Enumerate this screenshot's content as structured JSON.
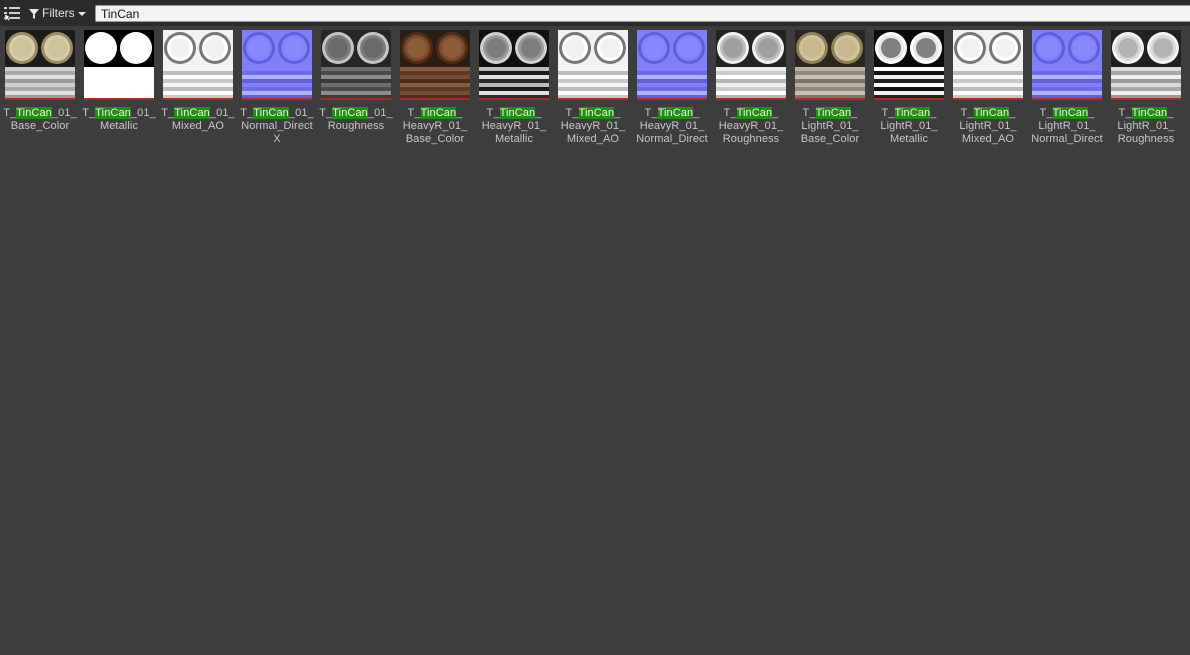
{
  "toolbar": {
    "view_icon": "view-options-icon",
    "filters_label": "Filters",
    "filter_icon": "funnel-icon",
    "dropdown_icon": "chevron-down-icon",
    "search_value": "TinCan"
  },
  "assets": [
    {
      "pre": "T_",
      "hl": "TinCan",
      "post": "_01_",
      "line2": "Base_Color",
      "line3": "",
      "kind": "basecolor"
    },
    {
      "pre": "T_",
      "hl": "TinCan",
      "post": "_01_",
      "line2": "Metallic",
      "line3": "",
      "kind": "metallic"
    },
    {
      "pre": "T_",
      "hl": "TinCan",
      "post": "_01_",
      "line2": "Mixed_AO",
      "line3": "",
      "kind": "ao"
    },
    {
      "pre": "T_",
      "hl": "TinCan",
      "post": "_01_",
      "line2": "Normal_Direct",
      "line3": "X",
      "kind": "normal"
    },
    {
      "pre": "T_",
      "hl": "TinCan",
      "post": "_01_",
      "line2": "Roughness",
      "line3": "",
      "kind": "roughness"
    },
    {
      "pre": "T_",
      "hl": "TinCan",
      "post": "_",
      "line2": "HeavyR_01_",
      "line3": "Base_Color",
      "kind": "heavybase"
    },
    {
      "pre": "T_",
      "hl": "TinCan",
      "post": "_",
      "line2": "HeavyR_01_",
      "line3": "Metallic",
      "kind": "heavymetal"
    },
    {
      "pre": "T_",
      "hl": "TinCan",
      "post": "_",
      "line2": "HeavyR_01_",
      "line3": "Mixed_AO",
      "kind": "ao"
    },
    {
      "pre": "T_",
      "hl": "TinCan",
      "post": "_",
      "line2": "HeavyR_01_",
      "line3": "Normal_Direct",
      "kind": "normal"
    },
    {
      "pre": "T_",
      "hl": "TinCan",
      "post": "_",
      "line2": "HeavyR_01_",
      "line3": "Roughness",
      "kind": "heavyrough"
    },
    {
      "pre": "T_",
      "hl": "TinCan",
      "post": "_",
      "line2": "LightR_01_",
      "line3": "Base_Color",
      "kind": "lightbase"
    },
    {
      "pre": "T_",
      "hl": "TinCan",
      "post": "_",
      "line2": "LightR_01_",
      "line3": "Metallic",
      "kind": "lightmetal"
    },
    {
      "pre": "T_",
      "hl": "TinCan",
      "post": "_",
      "line2": "LightR_01_",
      "line3": "Mixed_AO",
      "kind": "ao"
    },
    {
      "pre": "T_",
      "hl": "TinCan",
      "post": "_",
      "line2": "LightR_01_",
      "line3": "Normal_Direct",
      "kind": "normal"
    },
    {
      "pre": "T_",
      "hl": "TinCan",
      "post": "_",
      "line2": "LightR_01_",
      "line3": "Roughness",
      "kind": "lightrough"
    }
  ],
  "colors": {
    "background": "#3d3d3d",
    "toolbar": "#2b2b2b",
    "highlight": "#1f8e14",
    "thumb_underline": "#b0272b"
  }
}
